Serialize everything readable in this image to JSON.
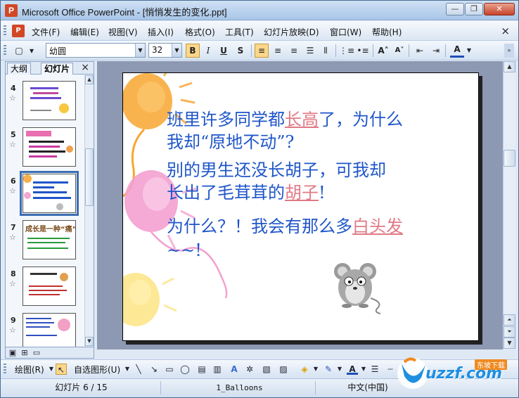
{
  "window": {
    "title": "Microsoft Office PowerPoint - [悄悄发生的变化.ppt]",
    "minimize_label": "—",
    "restore_label": "❐",
    "close_label": "✕"
  },
  "menu": {
    "items": [
      "文件(F)",
      "编辑(E)",
      "视图(V)",
      "插入(I)",
      "格式(O)",
      "工具(T)",
      "幻灯片放映(D)",
      "窗口(W)",
      "帮助(H)"
    ],
    "close_label": "×"
  },
  "format_toolbar": {
    "font_name": "幼圆",
    "font_size": "32",
    "bold_label": "B",
    "italic_label": "I",
    "underline_label": "U",
    "shadow_label": "S",
    "font_color_label": "A"
  },
  "left_panel": {
    "tab_outline": "大纲",
    "tab_slides": "幻灯片",
    "close_label": "×",
    "slides": [
      {
        "number": "4",
        "selected": false
      },
      {
        "number": "5",
        "selected": false
      },
      {
        "number": "6",
        "selected": true
      },
      {
        "number": "7",
        "selected": false
      },
      {
        "number": "8",
        "selected": false
      },
      {
        "number": "9",
        "selected": false
      }
    ],
    "thumb7_title": "成长是一种“痛”"
  },
  "slide": {
    "para1_line1_pre": "班里许多同学都",
    "para1_line1_hl": "长高",
    "para1_line1_post": "了，为什么",
    "para1_line2": "我却“原地不动”?",
    "para2_line1": "别的男生还没长胡子，可我却",
    "para2_line2_pre": "长出了毛茸茸的",
    "para2_line2_hl": "胡子",
    "para2_line2_post": "!",
    "para3_line1_pre": "为什么？！我会有那么多",
    "para3_line1_hl": "白头发",
    "para3_line2": "~~!"
  },
  "drawing_toolbar": {
    "draw_label": "绘图(R)",
    "autoshapes_label": "自选图形(U)"
  },
  "status": {
    "slide_info": "幻灯片 6 / 15",
    "design": "1_Balloons",
    "language": "中文(中国)"
  },
  "watermark": {
    "text": "uzzf.com",
    "sub": "东坡下载"
  },
  "colors": {
    "slide_text": "#1f56c9",
    "highlight_text": "#e07a86"
  }
}
